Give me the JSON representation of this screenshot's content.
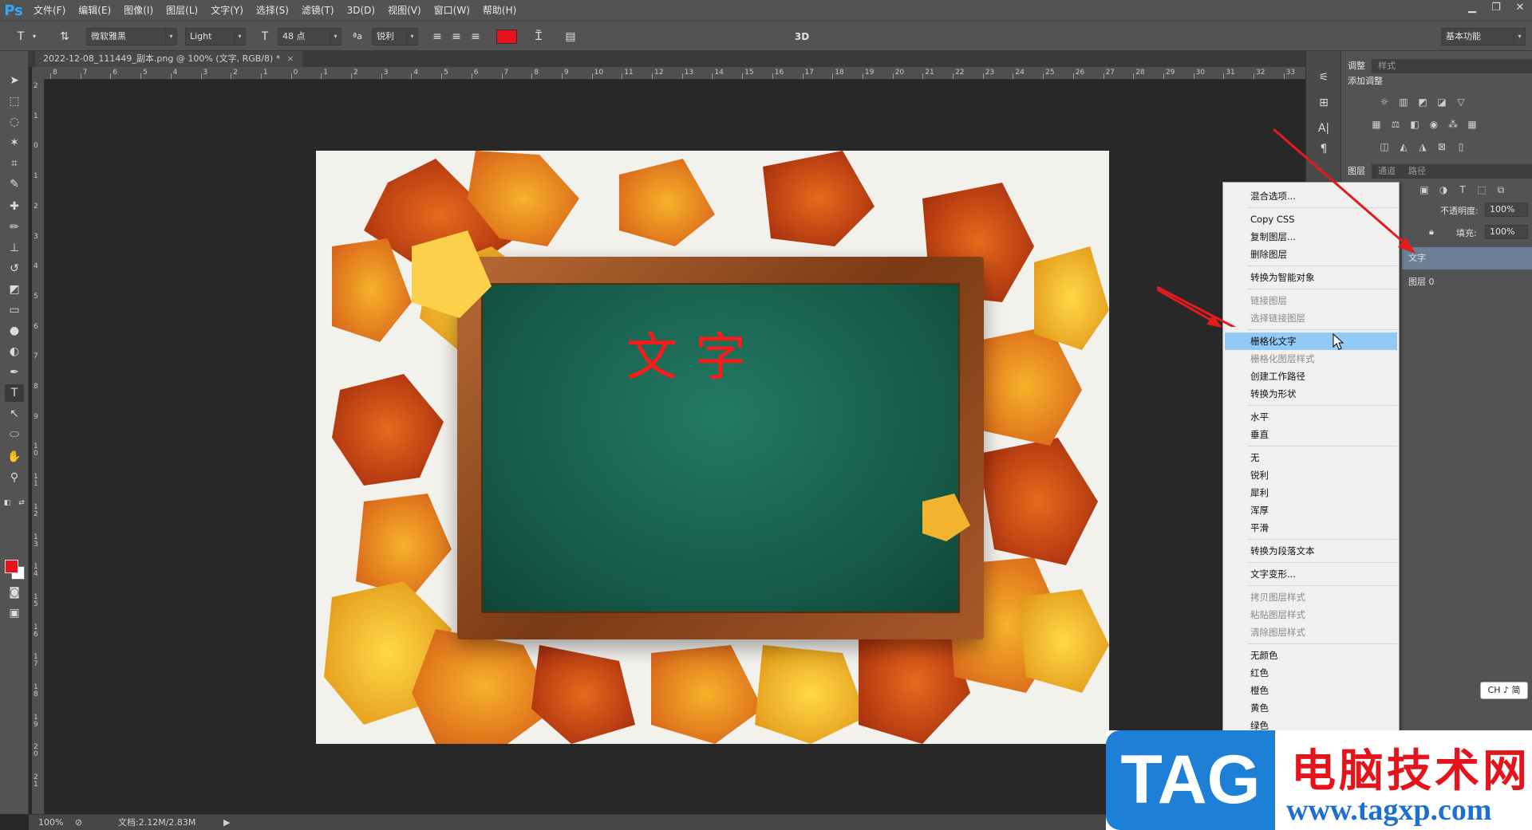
{
  "app": {
    "logo": "Ps"
  },
  "menubar": {
    "items": [
      "文件(F)",
      "编辑(E)",
      "图像(I)",
      "图层(L)",
      "文字(Y)",
      "选择(S)",
      "滤镜(T)",
      "3D(D)",
      "视图(V)",
      "窗口(W)",
      "帮助(H)"
    ]
  },
  "options": {
    "font_family": "微软雅黑",
    "font_style": "Light",
    "font_size": "48 点",
    "antialias": "锐利",
    "mode_3d": "3D",
    "workspace": "基本功能",
    "text_color": "#e5141c"
  },
  "document": {
    "tab_title": "2022-12-08_111449_副本.png @ 100% (文字, RGB/8) *",
    "close": "×",
    "canvas_text": "文字"
  },
  "rulers": {
    "h_labels": [
      "8",
      "7",
      "6",
      "5",
      "4",
      "3",
      "2",
      "1",
      "0",
      "1",
      "2",
      "3",
      "4",
      "5",
      "6",
      "7",
      "8",
      "9",
      "10",
      "11",
      "12",
      "13",
      "14",
      "15",
      "16",
      "17",
      "18",
      "19",
      "20",
      "21",
      "22",
      "23",
      "24",
      "25",
      "26",
      "27",
      "28",
      "29",
      "30",
      "31",
      "32",
      "33"
    ],
    "v_labels": [
      "2",
      "1",
      "0",
      "1",
      "2",
      "3",
      "4",
      "5",
      "6",
      "7",
      "8",
      "9",
      "1 0",
      "1 1",
      "1 2",
      "1 3",
      "1 4",
      "1 5",
      "1 6",
      "1 7",
      "1 8",
      "1 9",
      "2 0",
      "2 1"
    ]
  },
  "statusbar": {
    "zoom": "100%",
    "doc_info": "文档:2.12M/2.83M"
  },
  "panels": {
    "top_tabs": [
      "调整",
      "样式"
    ],
    "add_adjustment": "添加调整",
    "layer_tabs": [
      "图层",
      "通道",
      "路径"
    ],
    "opacity_label": "不透明度:",
    "opacity_value": "100%",
    "fill_label": "填充:",
    "fill_value": "100%",
    "layers": [
      "文字",
      "图层 0"
    ]
  },
  "context_menu": {
    "groups": [
      [
        {
          "label": "混合选项...",
          "enabled": true
        }
      ],
      [
        {
          "label": "Copy CSS",
          "enabled": true
        },
        {
          "label": "复制图层...",
          "enabled": true
        },
        {
          "label": "删除图层",
          "enabled": true
        }
      ],
      [
        {
          "label": "转换为智能对象",
          "enabled": true
        }
      ],
      [
        {
          "label": "链接图层",
          "enabled": false
        },
        {
          "label": "选择链接图层",
          "enabled": false
        }
      ],
      [
        {
          "label": "栅格化文字",
          "enabled": true,
          "highlighted": true
        },
        {
          "label": "栅格化图层样式",
          "enabled": false
        },
        {
          "label": "创建工作路径",
          "enabled": true
        },
        {
          "label": "转换为形状",
          "enabled": true
        }
      ],
      [
        {
          "label": "水平",
          "enabled": true
        },
        {
          "label": "垂直",
          "enabled": true
        }
      ],
      [
        {
          "label": "无",
          "enabled": true
        },
        {
          "label": "锐利",
          "enabled": true
        },
        {
          "label": "犀利",
          "enabled": true
        },
        {
          "label": "浑厚",
          "enabled": true
        },
        {
          "label": "平滑",
          "enabled": true
        }
      ],
      [
        {
          "label": "转换为段落文本",
          "enabled": true
        }
      ],
      [
        {
          "label": "文字变形...",
          "enabled": true
        }
      ],
      [
        {
          "label": "拷贝图层样式",
          "enabled": false
        },
        {
          "label": "粘贴图层样式",
          "enabled": false
        },
        {
          "label": "清除图层样式",
          "enabled": false
        }
      ],
      [
        {
          "label": "无颜色",
          "enabled": true
        },
        {
          "label": "红色",
          "enabled": true
        },
        {
          "label": "橙色",
          "enabled": true
        },
        {
          "label": "黄色",
          "enabled": true
        },
        {
          "label": "绿色",
          "enabled": true
        }
      ]
    ]
  },
  "ime": "CH ♪ 简",
  "watermark": {
    "tag": "TAG",
    "site_name": "电脑技术网",
    "url": "www.tagxp.com"
  }
}
